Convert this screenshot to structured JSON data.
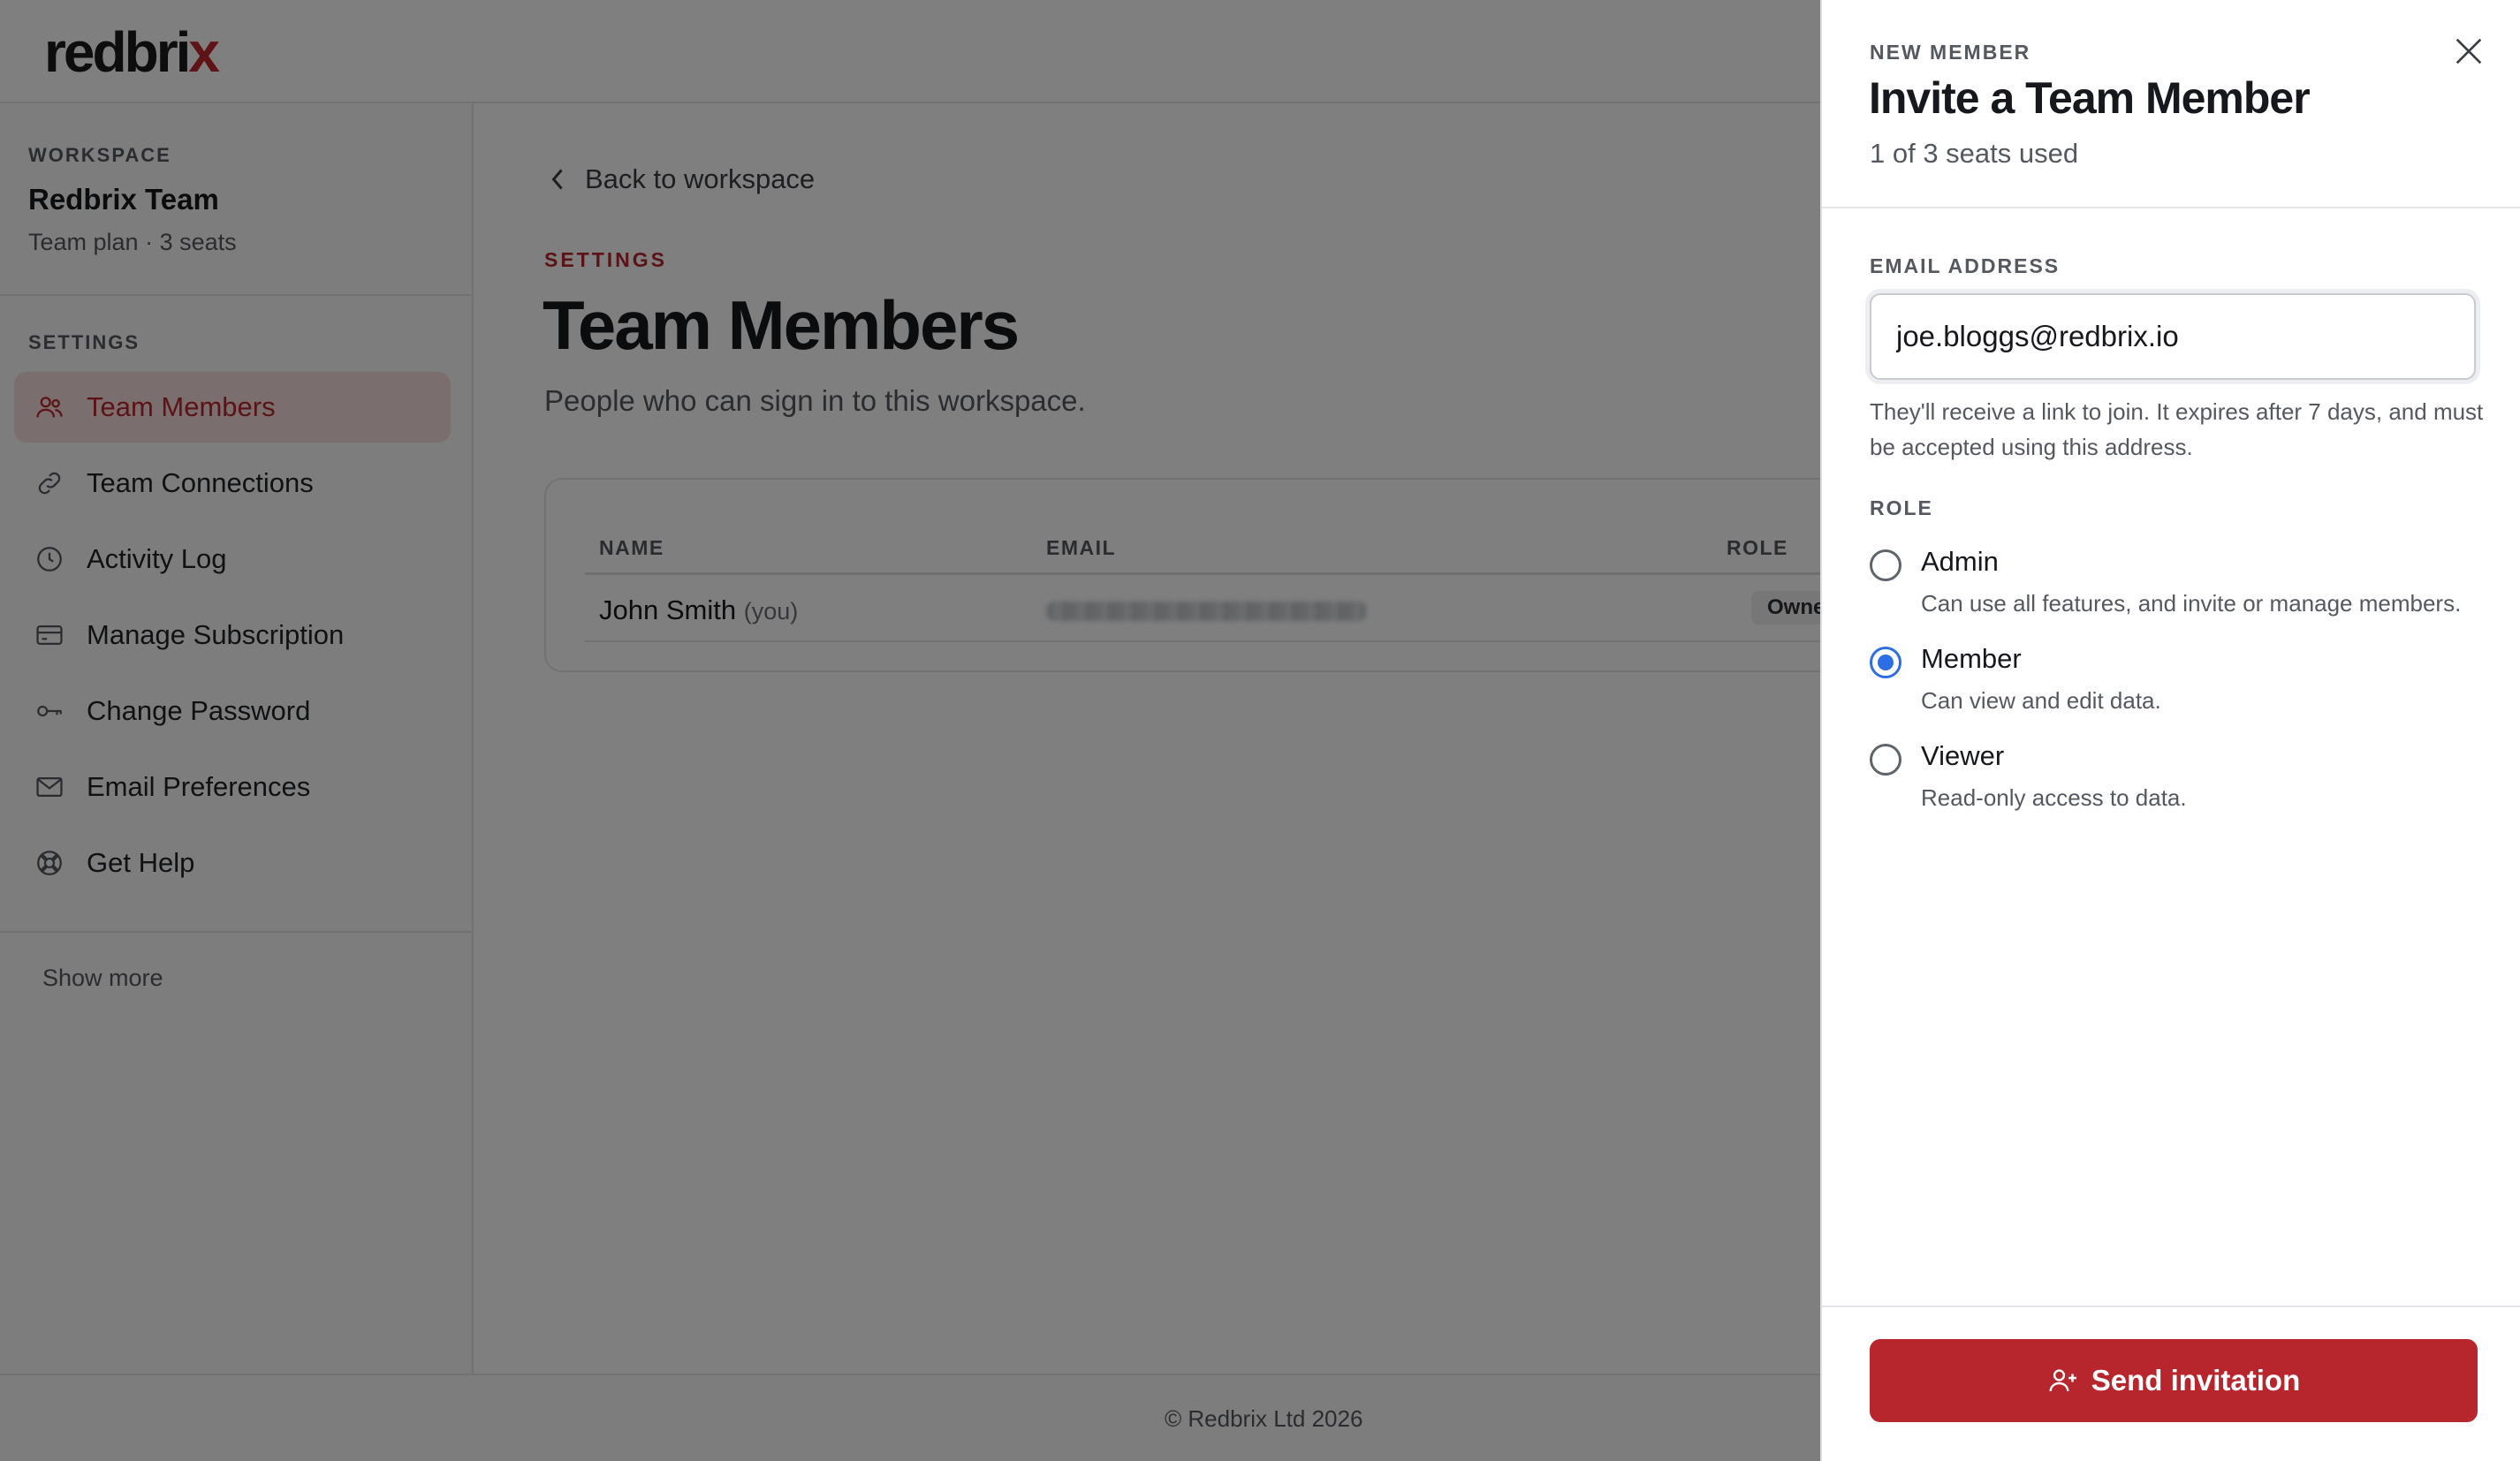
{
  "brand": {
    "logo_main": "redbri",
    "logo_x": "x",
    "accent": "#b8262d"
  },
  "sidebar": {
    "workspace_eyebrow": "WORKSPACE",
    "workspace_name": "Redbrix Team",
    "workspace_plan": "Team plan · 3 seats",
    "settings_eyebrow": "SETTINGS",
    "items": [
      {
        "label": "Team Members",
        "icon": "users-icon",
        "active": true
      },
      {
        "label": "Team Connections",
        "icon": "link-icon"
      },
      {
        "label": "Activity Log",
        "icon": "clock-icon"
      },
      {
        "label": "Manage Subscription",
        "icon": "credit-card-icon"
      },
      {
        "label": "Change Password",
        "icon": "key-icon"
      },
      {
        "label": "Email Preferences",
        "icon": "mail-icon"
      },
      {
        "label": "Get Help",
        "icon": "lifebuoy-icon"
      }
    ],
    "show_more": "Show more"
  },
  "main": {
    "back_link": "Back to workspace",
    "eyebrow": "SETTINGS",
    "title": "Team Members",
    "subtitle": "People who can sign in to this workspace.",
    "table": {
      "headers": [
        "NAME",
        "EMAIL",
        "ROLE"
      ],
      "rows": [
        {
          "name": "John Smith",
          "you": "(you)",
          "role": "Owner"
        }
      ]
    }
  },
  "footer": {
    "text": "© Redbrix Ltd 2026"
  },
  "drawer": {
    "eyebrow": "NEW MEMBER",
    "title": "Invite a Team Member",
    "seats": "1 of 3 seats used",
    "email_label": "EMAIL ADDRESS",
    "email_value": "joe.bloggs@redbrix.io",
    "hint": "They'll receive a link to join. It expires after 7 days, and must be accepted using this address.",
    "role_label": "ROLE",
    "roles": [
      {
        "name": "Admin",
        "desc": "Can use all features, and invite or manage members.",
        "checked": false
      },
      {
        "name": "Member",
        "desc": "Can view and edit data.",
        "checked": true
      },
      {
        "name": "Viewer",
        "desc": "Read-only access to data.",
        "checked": false
      }
    ],
    "send_label": "Send invitation"
  }
}
